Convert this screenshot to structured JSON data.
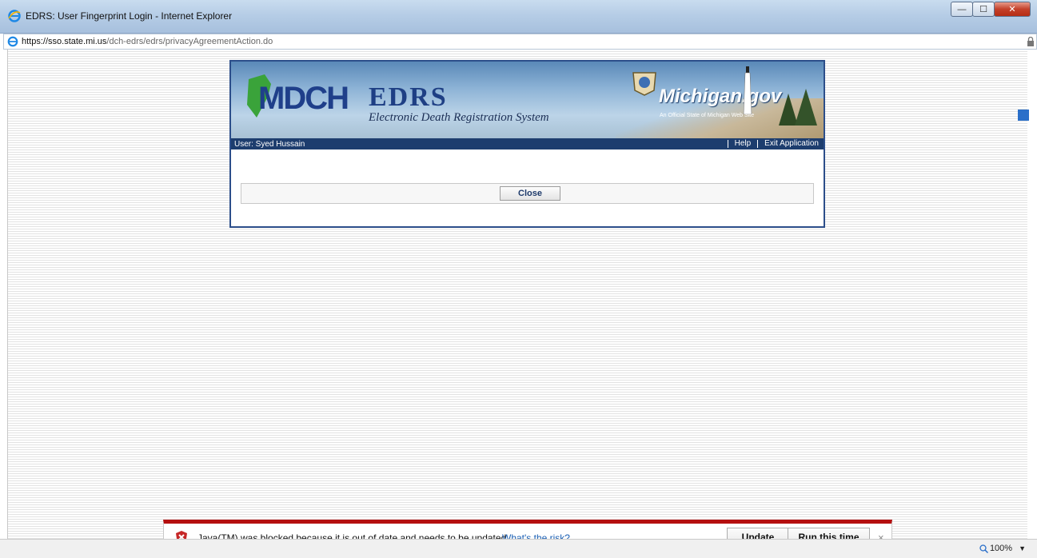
{
  "window": {
    "title": "EDRS: User Fingerprint Login - Internet Explorer",
    "controls": [
      "minimize",
      "maximize",
      "close"
    ]
  },
  "address_bar": {
    "url_prefix": "https://sso.",
    "url_host": "state.mi.us",
    "url_path": "/dch-edrs/edrs/privacyAgreementAction.do"
  },
  "banner": {
    "logo_text": "MDCH",
    "app_title": "EDRS",
    "app_subtitle": "Electronic Death Registration System",
    "site_brand": "Michigan.gov",
    "site_tagline": "An Official State of Michigan Web Site"
  },
  "userbar": {
    "user_label": "User: Syed Hussain",
    "help_link": "Help",
    "exit_link": "Exit Application"
  },
  "actions": {
    "close_label": "Close"
  },
  "notification": {
    "message": "Java(TM) was blocked because it is out of date and needs to be updated.",
    "risk_link": "What's the risk?",
    "update_label": "Update",
    "run_label": "Run this time",
    "dismiss": "×"
  },
  "statusbar": {
    "zoom": "100%"
  },
  "colors": {
    "userbar": "#1d3d6e",
    "notify_accent": "#b50f0f",
    "link": "#1a5fb4"
  }
}
